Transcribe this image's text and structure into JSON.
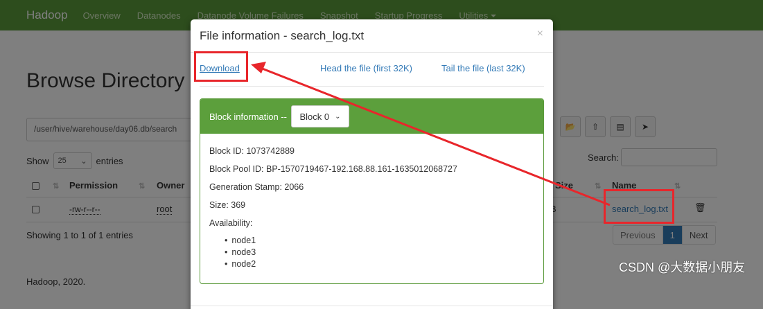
{
  "navbar": {
    "brand": "Hadoop",
    "items": [
      "Overview",
      "Datanodes",
      "Datanode Volume Failures",
      "Snapshot",
      "Startup Progress",
      "Utilities"
    ]
  },
  "page": {
    "title": "Browse Directory",
    "path": "/user/hive/warehouse/day06.db/search",
    "show_label": "Show",
    "show_value": "25",
    "entries_label": "entries",
    "search_label": "Search:",
    "table": {
      "headers": [
        "Permission",
        "Owner",
        "Size",
        "Name"
      ],
      "rows": [
        {
          "permission": "-rw-r--r--",
          "owner": "root",
          "size": "B",
          "name": "search_log.txt"
        }
      ]
    },
    "showing_text": "Showing 1 to 1 of 1 entries",
    "pager": {
      "previous": "Previous",
      "current": "1",
      "next": "Next"
    },
    "footer": "Hadoop, 2020."
  },
  "modal": {
    "title": "File information - search_log.txt",
    "close": "×",
    "links": {
      "download": "Download",
      "head": "Head the file (first 32K)",
      "tail": "Tail the file (last 32K)"
    },
    "panel": {
      "heading": "Block information --",
      "block_select": "Block 0",
      "block_id": "Block ID: 1073742889",
      "pool_id": "Block Pool ID: BP-1570719467-192.168.88.161-1635012068727",
      "gen_stamp": "Generation Stamp: 2066",
      "size": "Size: 369",
      "availability": "Availability:",
      "nodes": [
        "node1",
        "node3",
        "node2"
      ]
    }
  },
  "watermark": "CSDN @大数据小朋友",
  "colors": {
    "navbar": "#5a9a3a",
    "panel_header": "#5c9f3c",
    "link": "#337ab7",
    "annotation": "#e8262b"
  }
}
